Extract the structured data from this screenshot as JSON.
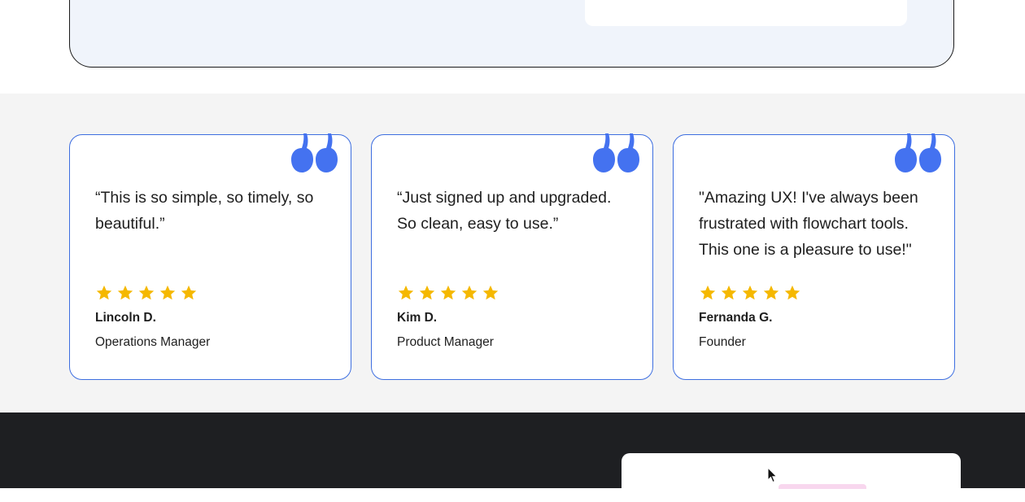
{
  "colors": {
    "accent": "#3d6ee0",
    "quote_mark": "#4472f0",
    "star": "#f5b800",
    "testimonials_bg": "#f4f4f4",
    "dark_bg": "#1e1f22",
    "hero_panel_bg": "#f0f4fb"
  },
  "testimonials": [
    {
      "quote": "“This is so simple, so timely, so beautiful.”",
      "rating": 5,
      "name": "Lincoln D.",
      "role": "Operations Manager",
      "icon": "quote-icon"
    },
    {
      "quote": "“Just signed up and upgraded. So clean, easy to use.”",
      "rating": 5,
      "name": "Kim D.",
      "role": "Product Manager",
      "icon": "quote-icon"
    },
    {
      "quote": "\"Amazing UX! I've always been frustrated with flowchart tools. This one is a pleasure to use!\"",
      "rating": 5,
      "name": "Fernanda G.",
      "role": "Founder",
      "icon": "quote-icon"
    }
  ],
  "icons": {
    "star": "star-icon",
    "cursor": "mouse-cursor-icon"
  }
}
